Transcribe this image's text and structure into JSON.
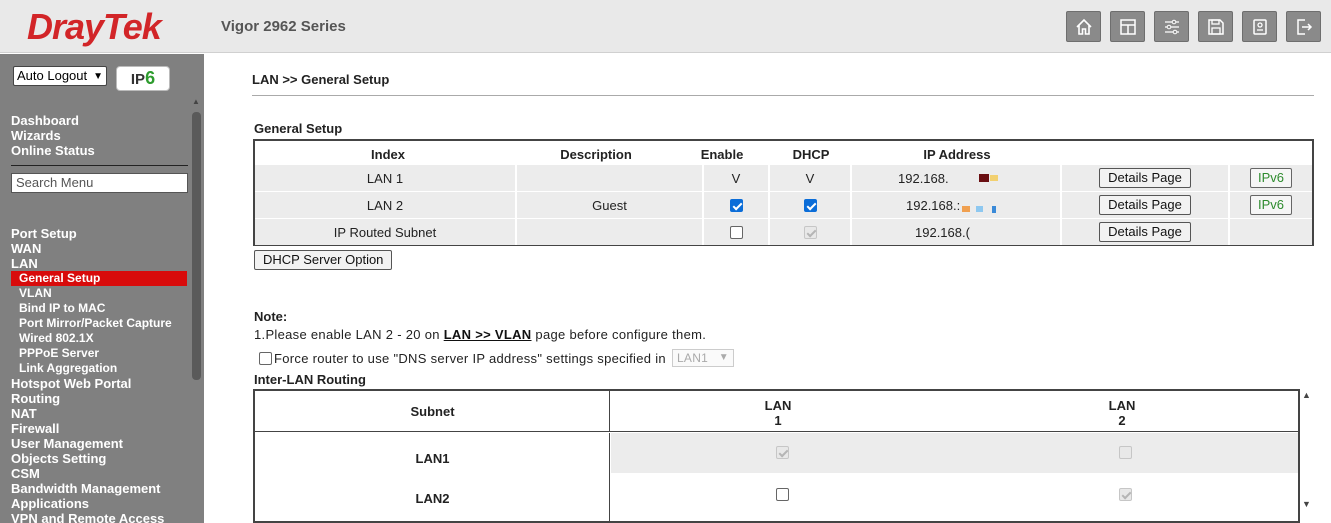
{
  "header": {
    "logo_text": "DrayTek",
    "model": "Vigor 2962 Series",
    "icons": [
      "home-icon",
      "dashboard-layout-icon",
      "sliders-icon",
      "save-icon",
      "config-backup-icon",
      "logout-icon"
    ]
  },
  "sidebar": {
    "auto_logout": "Auto Logout",
    "ipv6_badge_prefix": "IP",
    "ipv6_badge_suffix": "6",
    "top_links": [
      "Dashboard",
      "Wizards",
      "Online Status"
    ],
    "search_placeholder": "Search Menu",
    "groups": [
      "Port Setup",
      "WAN",
      "LAN"
    ],
    "lan_items": [
      "General Setup",
      "VLAN",
      "Bind IP to MAC",
      "Port Mirror/Packet Capture",
      "Wired 802.1X",
      "PPPoE Server",
      "Link Aggregation"
    ],
    "more_groups": [
      "Hotspot Web Portal",
      "Routing",
      "NAT",
      "Firewall",
      "User Management",
      "Objects Setting",
      "CSM",
      "Bandwidth Management",
      "Applications",
      "VPN and Remote Access"
    ]
  },
  "main": {
    "breadcrumb": "LAN >> General Setup",
    "general_setup_title": "General Setup",
    "columns": [
      "Index",
      "Description",
      "Enable",
      "DHCP",
      "IP Address"
    ],
    "rows": [
      {
        "index": "LAN 1",
        "description": "",
        "enable": "V",
        "dhcp": "V",
        "ip": "192.168.",
        "details": "Details Page",
        "ipv6": "IPv6"
      },
      {
        "index": "LAN 2",
        "description": "Guest",
        "enable_checked": true,
        "dhcp_checked": true,
        "ip": "192.168.:",
        "details": "Details Page",
        "ipv6": "IPv6"
      },
      {
        "index": "IP Routed Subnet",
        "description": "",
        "enable_checked": false,
        "dhcp_checked": true,
        "ip": "192.168.(",
        "details": "Details Page",
        "ipv6": ""
      }
    ],
    "dhcp_option_button": "DHCP Server Option",
    "note_title": "Note:",
    "note_prefix": "1.Please enable LAN 2 - 20 on ",
    "note_link": "LAN >> VLAN",
    "note_suffix": " page before configure them.",
    "force_dns_label": "Force router to use \"DNS server IP address\" settings specified in",
    "force_dns_select": "LAN1",
    "inter_lan_title": "Inter-LAN Routing",
    "inter_lan": {
      "subnet_header": "Subnet",
      "col1_top": "LAN",
      "col1_bottom": "1",
      "col2_top": "LAN",
      "col2_bottom": "2",
      "rows": [
        "LAN1",
        "LAN2"
      ]
    }
  }
}
